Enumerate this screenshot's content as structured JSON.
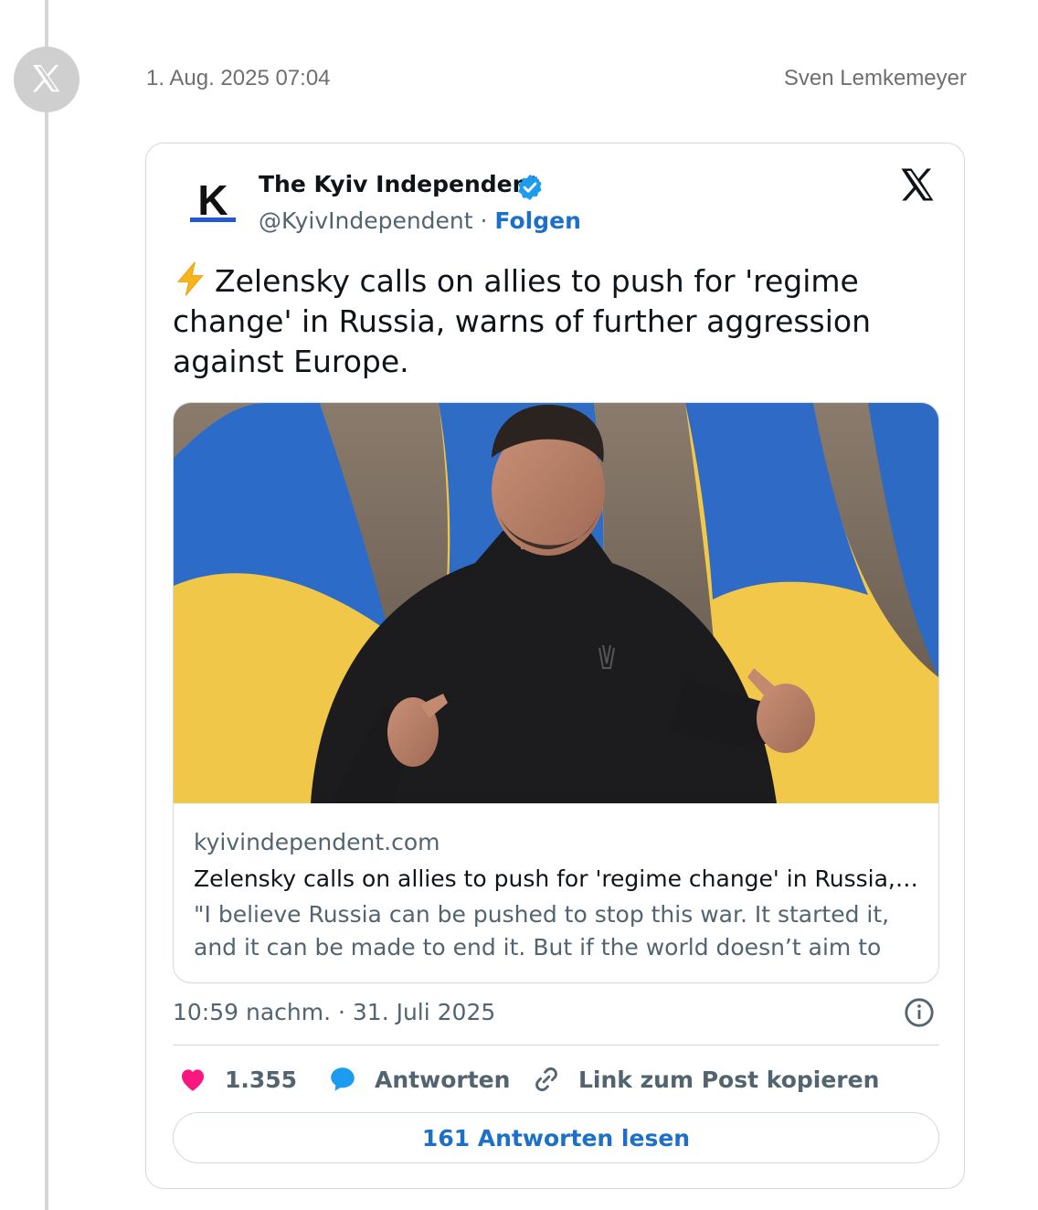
{
  "post_meta": {
    "date": "1. Aug. 2025 07:04",
    "author": "Sven Lemkemeyer",
    "source_icon": "x-logo-icon"
  },
  "tweet": {
    "avatar_letter": "K",
    "display_name": "The Kyiv Independent",
    "verified": true,
    "handle": "@KyivIndependent",
    "separator": " · ",
    "follow_label": "Folgen",
    "text": "Zelensky calls on allies to push for 'regime change' in Russia, warns of further aggression against Europe.",
    "text_icon": "lightning-icon",
    "link_card": {
      "domain": "kyivindependent.com",
      "title": "Zelensky calls on allies to push for 'regime change' in Russia, war...",
      "description": "\"I believe Russia can be pushed to stop this war. It started it, and it can be made to end it. But if the world doesn’t aim to change th..."
    },
    "timestamp": "10:59 nachm. · 31. Juli 2025",
    "actions": {
      "likes": "1.355",
      "reply_label": "Antworten",
      "copy_link_label": "Link zum Post kopieren"
    },
    "read_replies_label": "161 Antworten lesen"
  },
  "colors": {
    "link_blue": "#1d70c8",
    "like_pink": "#f91880",
    "verified_blue": "#1d9bf0",
    "muted_text": "#536471"
  }
}
